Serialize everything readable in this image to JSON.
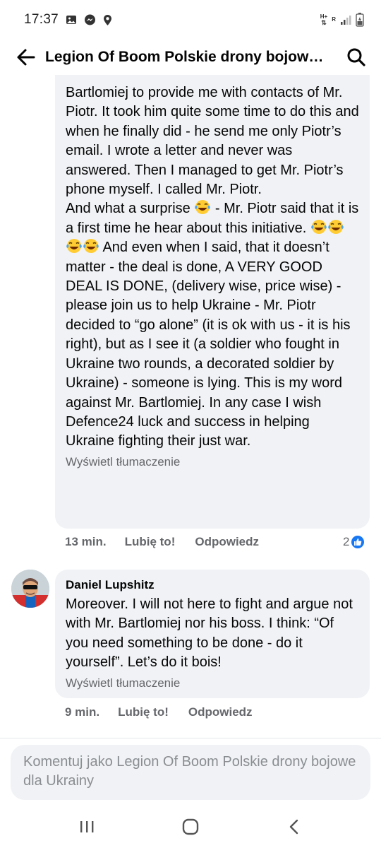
{
  "status_bar": {
    "time": "17:37",
    "network_top": "H+",
    "network_bottom": "R",
    "icons": [
      "gallery-icon",
      "messenger-icon",
      "location-icon",
      "signal-icon",
      "battery-icon"
    ]
  },
  "header": {
    "title": "Legion Of Boom Polskie drony bojowe dla Ukrainy",
    "back_icon": "arrow-left-icon",
    "search_icon": "search-icon"
  },
  "comments": [
    {
      "text": "Bartlomiej to provide me with contacts of Mr. Piotr. It took him quite some time to do this and when he finally did - he send me only Piotr’s email. I wrote a letter and never was answered. Then I managed to get Mr. Piotr’s phone myself. I called Mr. Piotr.",
      "text_part2_a": "And what a surprise ",
      "text_part2_b": " - Mr. Piotr said that it is a first time he hear about this initiative. ",
      "text_part2_c": " And even when I said, that it doesn’t matter - the deal is done, A VERY GOOD DEAL IS DONE, (delivery wise, price wise) - please join us to help Ukraine - Mr. Piotr decided to “go alone” (it is ok with us - it is his right), but as I see it (a soldier who fought in Ukraine two rounds, a decorated soldier by Ukraine) - someone is lying. This is my word against Mr. Bartlomiej. In any case I wish Defence24 luck and success in helping Ukraine fighting their just war.",
      "emoji": "tears-of-joy-emoji",
      "translate": "Wyświetl tłumaczenie",
      "time": "13 min.",
      "like": "Lubię to!",
      "reply": "Odpowiedz",
      "reaction_count": "2"
    },
    {
      "author": "Daniel Lupshitz",
      "text": "Moreover. I will not here to fight and argue not with Mr. Bartlomiej nor his boss. I think: “Of you need something to be done - do it yourself”. Let’s do it bois!",
      "translate": "Wyświetl tłumaczenie",
      "time": "9 min.",
      "like": "Lubię to!",
      "reply": "Odpowiedz"
    }
  ],
  "composer": {
    "placeholder": "Komentuj jako Legion Of Boom Polskie drony bojowe dla Ukrainy"
  },
  "nav_bar": {
    "icons": [
      "recent-apps-icon",
      "home-icon",
      "back-icon"
    ]
  },
  "colors": {
    "bubble": "#f0f2f5",
    "secondary_text": "#65676b",
    "like_blue": "#1877f2",
    "emoji_yellow": "#ffcc33"
  }
}
